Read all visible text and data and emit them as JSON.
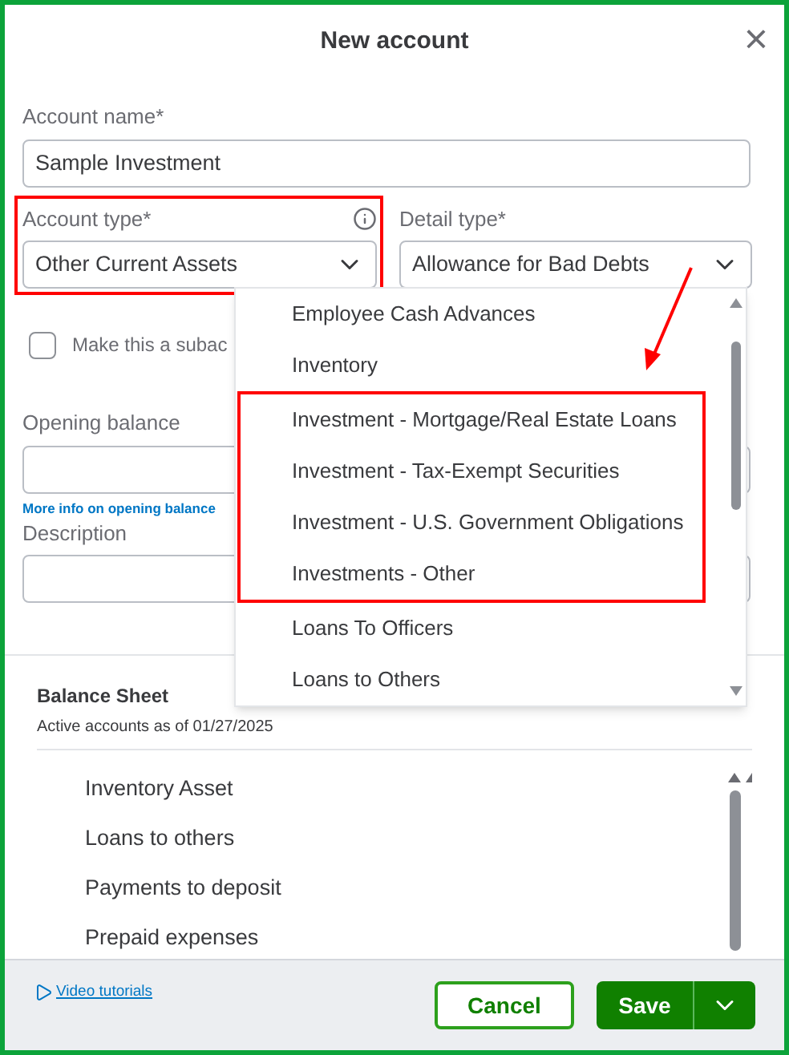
{
  "dialog": {
    "title": "New account",
    "close": "×"
  },
  "account_name": {
    "label": "Account name*",
    "value": "Sample Investment"
  },
  "account_type": {
    "label": "Account type*",
    "value": "Other Current Assets",
    "annotated": true
  },
  "detail_type": {
    "label": "Detail type*",
    "value": "Allowance for Bad Debts"
  },
  "subaccount": {
    "label": "Make this a subac",
    "checked": false
  },
  "opening_balance": {
    "label": "Opening balance",
    "link": "More info on opening balance"
  },
  "description": {
    "label": "Description"
  },
  "dropdown": {
    "options": [
      {
        "label": "Employee Cash Advances",
        "highlighted": false
      },
      {
        "label": "Inventory",
        "highlighted": false
      },
      {
        "label": "Investment - Mortgage/Real Estate Loans",
        "highlighted": true
      },
      {
        "label": "Investment - Tax-Exempt Securities",
        "highlighted": true
      },
      {
        "label": "Investment - U.S. Government Obligations",
        "highlighted": true
      },
      {
        "label": "Investments - Other",
        "highlighted": true
      },
      {
        "label": "Loans To Officers",
        "highlighted": false
      },
      {
        "label": "Loans to Others",
        "highlighted": false
      }
    ]
  },
  "balance_sheet": {
    "title": "Balance Sheet",
    "subtitle": "Active accounts as of 01/27/2025",
    "accounts": [
      "Inventory Asset",
      "Loans to others",
      "Payments to deposit",
      "Prepaid expenses"
    ]
  },
  "footer": {
    "video_link": "Video tutorials",
    "cancel": "Cancel",
    "save": "Save"
  }
}
